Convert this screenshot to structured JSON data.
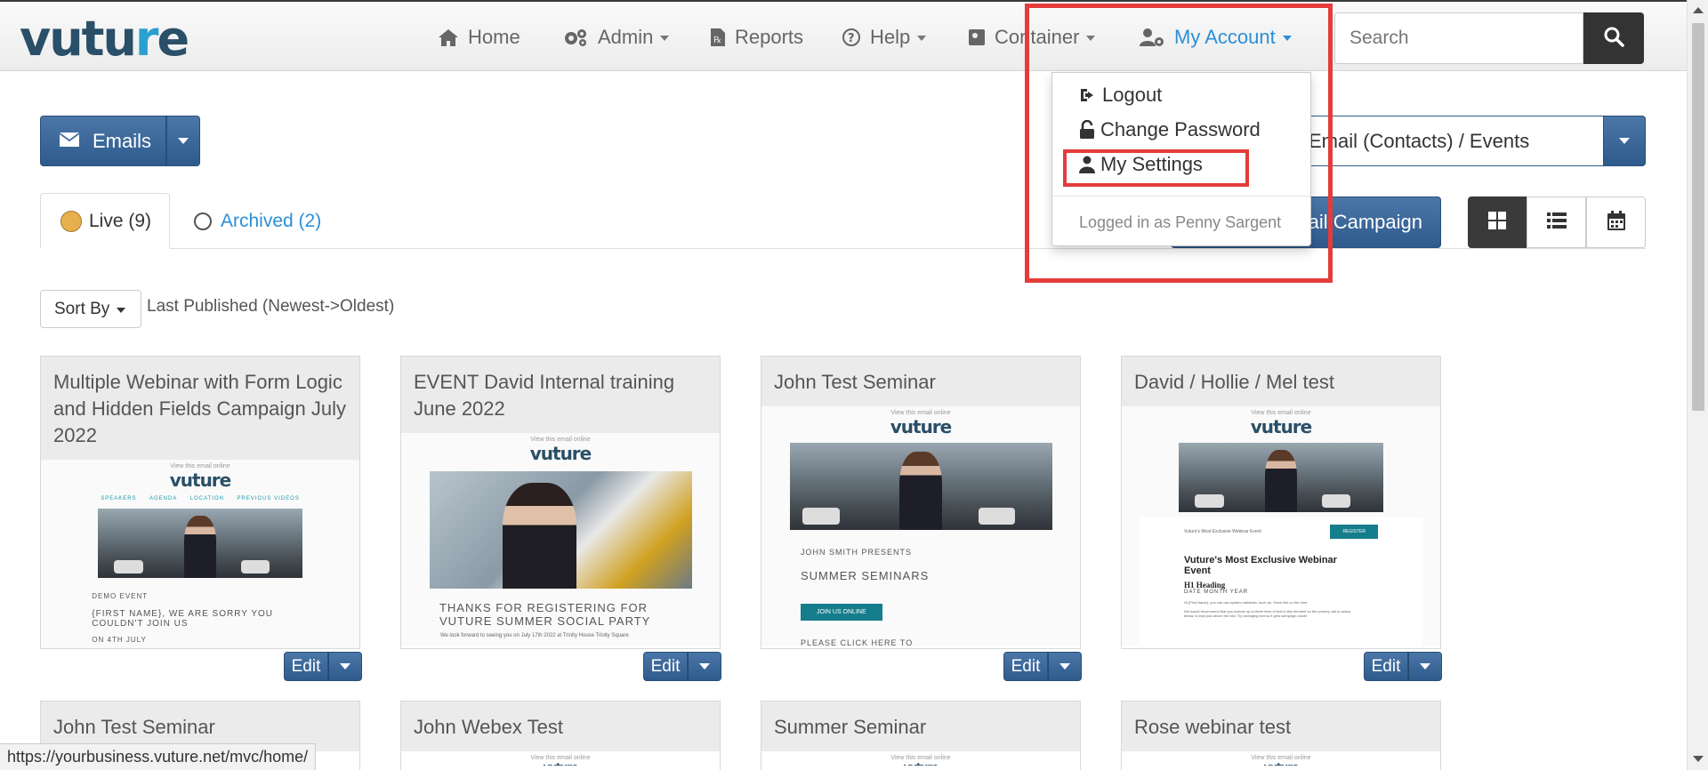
{
  "logo": {
    "text_a": "vutu",
    "text_dot": "r",
    "text_b": "e"
  },
  "nav": {
    "home": "Home",
    "admin": "Admin",
    "reports": "Reports",
    "help": "Help",
    "container": "Container",
    "my_account": "My Account"
  },
  "search": {
    "placeholder": "Search"
  },
  "toolbar": {
    "emails_label": "Emails",
    "type_select_value": "Email (Contacts) / Events",
    "new_campaign_label": "Email Campaign"
  },
  "tabs": {
    "live": "Live (9)",
    "archived": "Archived (2)"
  },
  "sort": {
    "button_label": "Sort By",
    "current": "Last Published (Newest->Oldest)"
  },
  "account_menu": {
    "logout": "Logout",
    "change_password": "Change Password",
    "my_settings": "My Settings",
    "logged_in_as": "Logged in as Penny Sargent"
  },
  "cards": [
    {
      "title": "Multiple Webinar with Form Logic and Hidden Fields Campaign July 2022",
      "edit": "Edit"
    },
    {
      "title": "EVENT David Internal training June 2022",
      "edit": "Edit"
    },
    {
      "title": "John Test Seminar",
      "edit": "Edit"
    },
    {
      "title": "David / Hollie / Mel test",
      "edit": "Edit"
    },
    {
      "title": "John Test Seminar"
    },
    {
      "title": "John Webex Test"
    },
    {
      "title": "Summer Seminar"
    },
    {
      "title": "Rose webinar test"
    }
  ],
  "thumbs": {
    "view_online": "View this email online",
    "brand": "vuture",
    "c1_nav": [
      "SPEAKERS",
      "AGENDA",
      "LOCATION",
      "PREVIOUS VIDEOS"
    ],
    "c1_line1": "DEMO EVENT",
    "c1_line2": "{FIRST NAME}, WE ARE SORRY YOU COULDN'T  JOIN US",
    "c1_line3": "ON 4TH JULY",
    "c2_line1": "THANKS FOR REGISTERING FOR VUTURE SUMMER SOCIAL PARTY",
    "c2_line2": "We look forward to seeing you on July 17th 2022 at Trinity House Trinity Square",
    "c3_line1": "JOHN SMITH PRESENTS",
    "c3_line2": "SUMMER SEMINARS",
    "c3_btn": "JOIN US ONLINE",
    "c3_line3": "PLEASE CLICK HERE TO",
    "c4_event": "Vuture's Most Exclusive Webinar Event",
    "c4_btn": "REGISTER",
    "c4_heading": "Vuture's Most Exclusive Webinar Event",
    "c4_h1": "H1 Heading",
    "c4_date": "DATE MONTH YEAR",
    "c4_body": "Hi {First Name}, you can use system variables, such as. Show link on the here",
    "c4_body2": "We would recommend that you include up to three lines of text in this element so the primary call to action, below, is kept just above the fold. Try arranging text so it gets campaign closer"
  },
  "status_bar": {
    "url": "https://yourbusiness.vuture.net/mvc/home/"
  },
  "colors": {
    "primary": "#2e5a8c",
    "link": "#2a8fd8",
    "highlight": "#e53b3b",
    "live_dot": "#e6b04e"
  }
}
